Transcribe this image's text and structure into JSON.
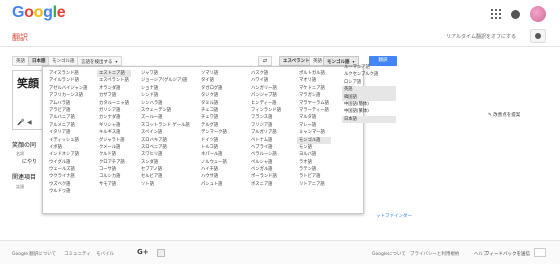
{
  "logo": {
    "letters": [
      "G",
      "o",
      "o",
      "g",
      "l",
      "e"
    ],
    "colors": [
      "#4285f4",
      "#ea4335",
      "#fbbc05",
      "#4285f4",
      "#34a853",
      "#ea4335"
    ]
  },
  "header": {
    "page_title": "翻訳",
    "realtime_label": "リアルタイム翻訳をオフにする"
  },
  "source_toolbar": {
    "buttons": [
      "英語",
      "日本語",
      "モンゴル語",
      "言語を検出する"
    ]
  },
  "target_toolbar": {
    "buttons": [
      "エスペラント語",
      "英語",
      "モンゴル語"
    ],
    "translate_label": "翻訳"
  },
  "source": {
    "text": "笑顔",
    "left_heading": "笑顔の同",
    "left_sub": "名詞",
    "left_line": "にやり",
    "related_heading": "関連項目",
    "related_sub": "笑顔"
  },
  "source_languages": {
    "columns": [
      [
        "アイスランド語",
        "アイルランド語",
        "アゼルバイジャン語",
        "アフリカーンス語",
        "アムハラ語",
        "アラビア語",
        "アルバニア語",
        "アルメニア語",
        "イタリア語",
        "イディッシュ語",
        "イボ語",
        "インドネシア語",
        "ウイグル語",
        "ウェールズ語",
        "ウクライナ語",
        "ウズベク語",
        "ウルドゥ語"
      ],
      [
        "エストニア語",
        "エスペラント語",
        "オランダ語",
        "カザフ語",
        "カタルーニャ語",
        "ガリシア語",
        "カンナダ語",
        "ギリシャ語",
        "キルギス語",
        "グジャラト語",
        "クメール語",
        "クルド語",
        "クロアチア語",
        "コーサ語",
        "コルシカ語",
        "サモア語"
      ],
      [
        "ジャワ語",
        "ジョージア(グルジア)語",
        "ショナ語",
        "シンド語",
        "シンハラ語",
        "スウェーデン語",
        "ズールー語",
        "スコットランド ゲール語",
        "スペイン語",
        "スロバキア語",
        "スロベニア語",
        "スワヒリ語",
        "スンダ語",
        "セブアノ語",
        "セルビア語",
        "ソト語"
      ],
      [
        "ソマリ語",
        "タイ語",
        "タガログ語",
        "タジク語",
        "タミル語",
        "チェコ語",
        "チェワ語",
        "テルグ語",
        "デンマーク語",
        "ドイツ語",
        "トルコ語",
        "ネパール語",
        "ノルウェー語",
        "ハイチ語",
        "ハウサ語",
        "パシュト語"
      ],
      [
        "バスク語",
        "ハワイ語",
        "ハンガリー語",
        "パンジャブ語",
        "ヒンディー語",
        "フィンランド語",
        "フランス語",
        "フリジア語",
        "ブルガリア語",
        "ベトナム語",
        "ヘブライ語",
        "ベラルーシ語",
        "ペルシャ語",
        "ベンガル語",
        "ポーランド語",
        "ボスニア語"
      ],
      [
        "ポルトガル語",
        "マオリ語",
        "マケドニア語",
        "マラガシ語",
        "マラヤーラム語",
        "マラーティー語",
        "マルタ語",
        "マレー語",
        "ミャンマー語",
        "モンゴル語",
        "モン語",
        "ヨルバ語",
        "ラオ語",
        "ラテン語",
        "ラトビア語",
        "リトアニア語"
      ]
    ],
    "highlighted": "エストニア語"
  },
  "target_languages": {
    "items": [
      "ルーマニア語",
      "ルクセンブルク語",
      "ロシア語",
      "英語",
      "韓国語",
      "中国語(簡体)",
      "中国語(繁体)",
      "日本語"
    ],
    "highlighted": [
      "英語",
      "韓国語",
      "日本語"
    ],
    "selected_in_left": "モンゴル語"
  },
  "suggest_label": "改善点を提案",
  "phrasefinder_label": "ットファインダー",
  "footer": {
    "items": [
      "Google 翻訳について",
      "コミュニティ",
      "モバイル"
    ],
    "gplus": "G+",
    "right_items": [
      "Googleについて",
      "プライバシーと利用規約",
      "ヘルプ"
    ],
    "feedback": "フィードバックを送信"
  }
}
